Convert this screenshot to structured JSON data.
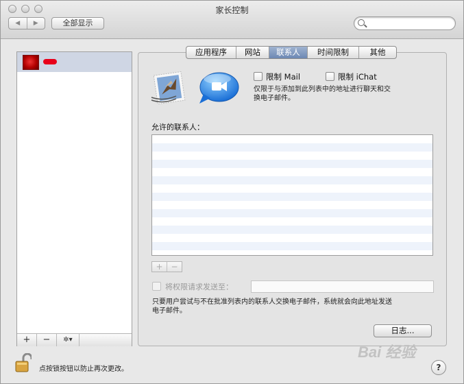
{
  "window": {
    "title": "家长控制"
  },
  "toolbar": {
    "back_icon": "back-arrow-icon",
    "forward_icon": "forward-arrow-icon",
    "back_glyph": "◀",
    "forward_glyph": "▶",
    "show_all_label": "全部显示",
    "search_value": ""
  },
  "sidebar": {
    "users": [
      {
        "name_redacted": true,
        "avatar": "red-rose"
      }
    ],
    "tools": {
      "add": "+",
      "remove": "−",
      "action": "✲▾"
    }
  },
  "tabs": [
    {
      "label": "应用程序",
      "active": false
    },
    {
      "label": "网站",
      "active": false
    },
    {
      "label": "联系人",
      "active": true
    },
    {
      "label": "时间限制",
      "active": false
    },
    {
      "label": "其他",
      "active": false
    }
  ],
  "contacts": {
    "limit_mail_label": "限制 Mail",
    "limit_ichat_label": "限制 iChat",
    "limit_mail_checked": false,
    "limit_ichat_checked": false,
    "description": "仅限于与添加到此列表中的地址进行聊天和交换电子邮件。",
    "description_line1": "仅限于与添加到此列表中的地址进行聊天和交",
    "description_line2": "换电子邮件。",
    "allowed_label": "允许的联系人：",
    "allowed_contacts": [],
    "add_label": "+",
    "remove_label": "−",
    "send_permission_label": "将权限请求发送至：",
    "send_permission_checked": false,
    "send_permission_value": "",
    "send_note_line1": "只要用户尝试与不在批准列表内的联系人交换电子邮件，系统就会向此地址发送",
    "send_note_line2": "电子邮件。",
    "log_button": "日志..."
  },
  "footer": {
    "lock_text": "点按锁按钮以防止再次更改。",
    "help_label": "?"
  },
  "watermark": "Bai 经验",
  "colors": {
    "selected_tab": "#7890bc",
    "list_stripe": "#eef3fb",
    "sidebar_selection": "#cfd6e4"
  }
}
